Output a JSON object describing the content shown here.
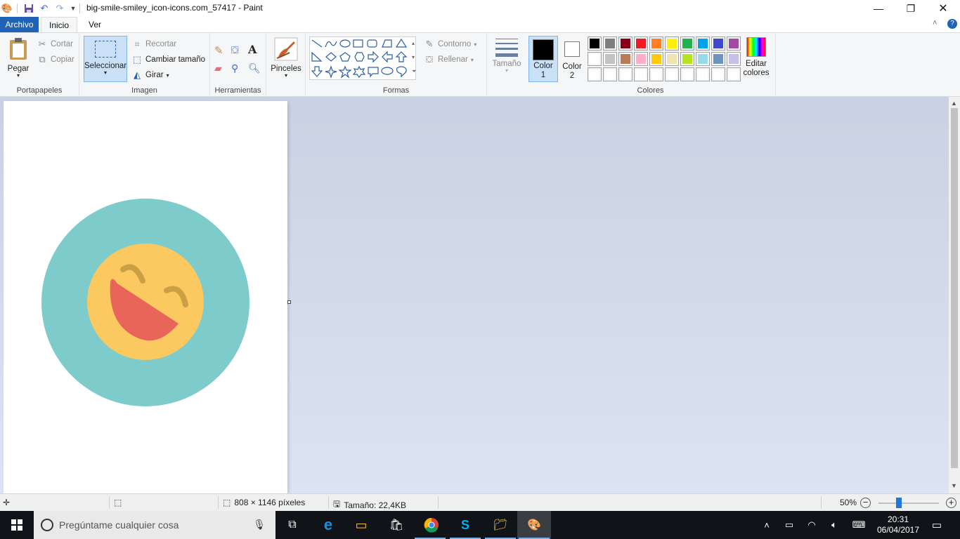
{
  "titlebar": {
    "title": "big-smile-smiley_icon-icons.com_57417 - Paint",
    "minimize_icon": "minimize-icon",
    "maximize_icon": "restore-icon",
    "close_icon": "close-icon"
  },
  "tabs": {
    "file": "Archivo",
    "home": "Inicio",
    "view": "Ver"
  },
  "ribbon": {
    "clipboard": {
      "label": "Portapapeles",
      "paste": "Pegar",
      "cut": "Cortar",
      "copy": "Copiar"
    },
    "image": {
      "label": "Imagen",
      "select": "Seleccionar",
      "crop": "Recortar",
      "resize": "Cambiar tamaño",
      "rotate": "Girar"
    },
    "tools": {
      "label": "Herramientas"
    },
    "brushes": {
      "label": "Pinceles"
    },
    "shapes": {
      "label": "Formas",
      "outline": "Contorno",
      "fill": "Rellenar"
    },
    "size": {
      "label": "Tamaño"
    },
    "colors": {
      "label": "Colores",
      "color1_line1": "Color",
      "color1_line2": "1",
      "color2_line1": "Color",
      "color2_line2": "2",
      "edit_line1": "Editar",
      "edit_line2": "colores",
      "color1": "#000000",
      "color2": "#ffffff",
      "row1": [
        "#000000",
        "#7f7f7f",
        "#880015",
        "#ed1c24",
        "#ff7f27",
        "#fff200",
        "#22b14c",
        "#00a2e8",
        "#3f48cc",
        "#a349a4"
      ],
      "row2": [
        "#ffffff",
        "#c3c3c3",
        "#b97a57",
        "#ffaec9",
        "#ffc90e",
        "#efe4b0",
        "#b5e61d",
        "#99d9ea",
        "#7092be",
        "#c8bfe7"
      ],
      "row3": [
        "#ffffff",
        "#ffffff",
        "#ffffff",
        "#ffffff",
        "#ffffff",
        "#ffffff",
        "#ffffff",
        "#ffffff",
        "#ffffff",
        "#ffffff"
      ]
    }
  },
  "image": {
    "bg": "#7ecbcb",
    "face": "#fbc95f",
    "mouth": "#e9655a",
    "eyes": "#c9a043"
  },
  "status": {
    "dimensions": "808 × 1146 píxeles",
    "size": "Tamaño: 22,4KB",
    "zoom": "50%",
    "zoom_level": 0.5
  },
  "taskbar": {
    "search_placeholder": "Pregúntame cualquier cosa",
    "time": "20:31",
    "date": "06/04/2017"
  }
}
